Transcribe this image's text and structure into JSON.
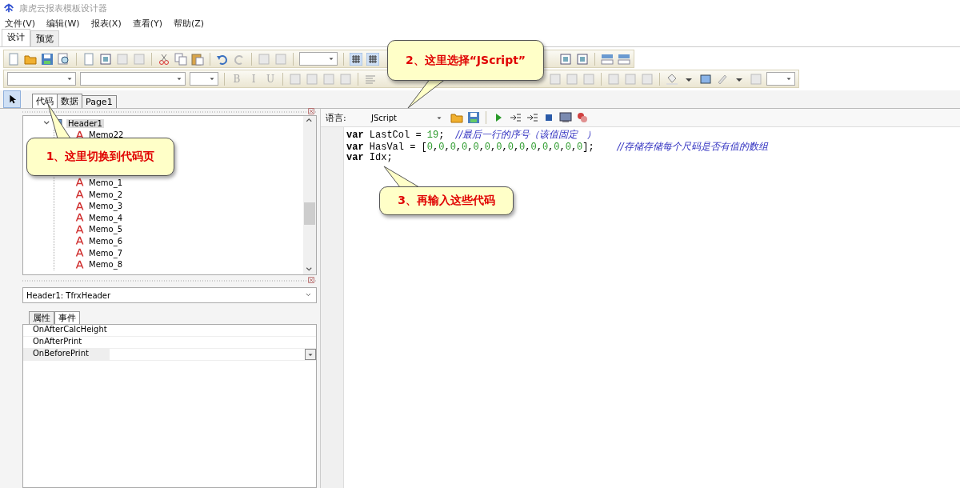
{
  "window": {
    "title": "康虎云报表模板设计器"
  },
  "menu": [
    "文件(V)",
    "编辑(W)",
    "报表(X)",
    "查看(Y)",
    "帮助(Z)"
  ],
  "mode_tabs": [
    {
      "label": "设计",
      "selected": true
    },
    {
      "label": "预览",
      "selected": false
    }
  ],
  "format_buttons": [
    "B",
    "I",
    "U"
  ],
  "page_tabs": [
    {
      "label": "代码",
      "selected": true
    },
    {
      "label": "数据",
      "selected": false
    },
    {
      "label": "Page1",
      "selected": false
    }
  ],
  "tree": [
    {
      "label": "Header1",
      "selected": true,
      "expanded": true,
      "children": [
        {
          "label": "Memo22",
          "selected": false
        },
        {
          "label": "Memo_1",
          "selected": false
        },
        {
          "label": "Memo_2",
          "selected": false
        },
        {
          "label": "Memo_3",
          "selected": false
        },
        {
          "label": "Memo_4",
          "selected": false
        },
        {
          "label": "Memo_5",
          "selected": false
        },
        {
          "label": "Memo_6",
          "selected": false
        },
        {
          "label": "Memo_7",
          "selected": false
        },
        {
          "label": "Memo_8",
          "selected": false
        }
      ]
    }
  ],
  "object_selector": {
    "value": "Header1: TfrxHeader"
  },
  "inspector_tabs": [
    {
      "label": "属性",
      "selected": false
    },
    {
      "label": "事件",
      "selected": true
    }
  ],
  "events": [
    {
      "name": "OnAfterCalcHeight",
      "selected": false
    },
    {
      "name": "OnAfterPrint",
      "selected": false
    },
    {
      "name": "OnBeforePrint",
      "selected": true
    }
  ],
  "code_toolbar": {
    "language_label": "语言:",
    "language": "JScript"
  },
  "code_lines": [
    [
      {
        "kind": "keyword",
        "text": "var"
      },
      {
        "kind": "plain",
        "text": " LastCol = "
      },
      {
        "kind": "number",
        "text": "19"
      },
      {
        "kind": "plain",
        "text": ";  "
      },
      {
        "kind": "comment",
        "text": "//最后一行的序号（该值固定   ）"
      }
    ],
    [
      {
        "kind": "keyword",
        "text": "var"
      },
      {
        "kind": "plain",
        "text": " HasVal = ["
      },
      {
        "kind": "number",
        "text": "0"
      },
      {
        "kind": "plain",
        "text": ","
      },
      {
        "kind": "number",
        "text": "0"
      },
      {
        "kind": "plain",
        "text": ","
      },
      {
        "kind": "number",
        "text": "0"
      },
      {
        "kind": "plain",
        "text": ","
      },
      {
        "kind": "number",
        "text": "0"
      },
      {
        "kind": "plain",
        "text": ","
      },
      {
        "kind": "number",
        "text": "0"
      },
      {
        "kind": "plain",
        "text": ","
      },
      {
        "kind": "number",
        "text": "0"
      },
      {
        "kind": "plain",
        "text": ","
      },
      {
        "kind": "number",
        "text": "0"
      },
      {
        "kind": "plain",
        "text": ","
      },
      {
        "kind": "number",
        "text": "0"
      },
      {
        "kind": "plain",
        "text": ","
      },
      {
        "kind": "number",
        "text": "0"
      },
      {
        "kind": "plain",
        "text": ","
      },
      {
        "kind": "number",
        "text": "0"
      },
      {
        "kind": "plain",
        "text": ","
      },
      {
        "kind": "number",
        "text": "0"
      },
      {
        "kind": "plain",
        "text": ","
      },
      {
        "kind": "number",
        "text": "0"
      },
      {
        "kind": "plain",
        "text": ","
      },
      {
        "kind": "number",
        "text": "0"
      },
      {
        "kind": "plain",
        "text": ","
      },
      {
        "kind": "number",
        "text": "0"
      },
      {
        "kind": "plain",
        "text": "];    "
      },
      {
        "kind": "comment",
        "text": "//存储存储每个尺码是否有值的数组"
      }
    ],
    [
      {
        "kind": "keyword",
        "text": "var"
      },
      {
        "kind": "plain",
        "text": " Idx;"
      }
    ]
  ],
  "callouts": [
    {
      "text": "1、这里切换到代码页",
      "kind": "tab"
    },
    {
      "text": "2、这里选择“JScript”",
      "kind": "language"
    },
    {
      "text": "3、再输入这些代码",
      "kind": "code"
    }
  ]
}
